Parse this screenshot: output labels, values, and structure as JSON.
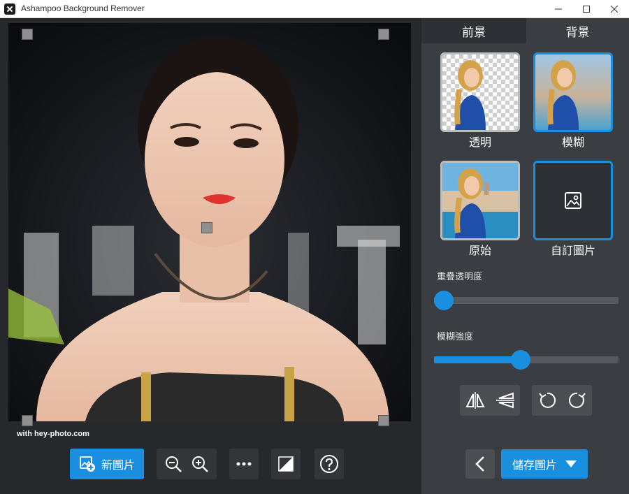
{
  "window": {
    "title": "Ashampoo Background Remover"
  },
  "canvas": {
    "watermark": "with hey-photo.com"
  },
  "toolbar": {
    "new_image_label": "新圖片"
  },
  "panel": {
    "tabs": [
      {
        "label": "前景"
      },
      {
        "label": "背景"
      }
    ],
    "options": [
      {
        "label": "透明"
      },
      {
        "label": "模糊"
      },
      {
        "label": "原始"
      },
      {
        "label": "自訂圖片"
      }
    ],
    "sliders": {
      "overlay_label": "重疊透明度",
      "overlay_value": 0.03,
      "blur_label": "模糊強度",
      "blur_value": 0.47
    },
    "save_label": "儲存圖片"
  },
  "colors": {
    "accent": "#1a8fe0",
    "panel": "#3a3d42",
    "canvas_bg": "#26282c"
  }
}
